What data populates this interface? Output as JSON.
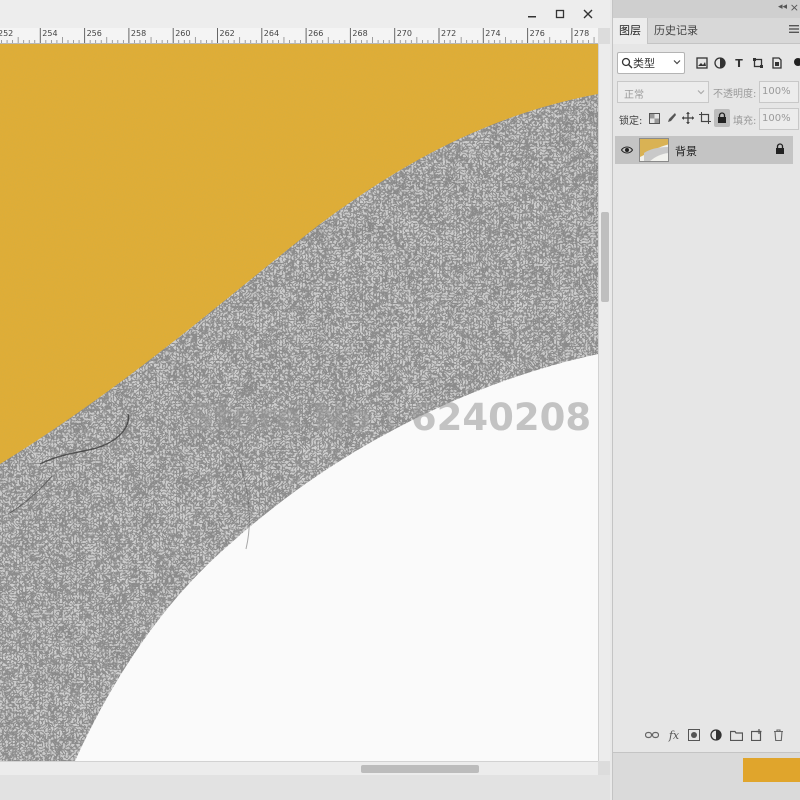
{
  "document": {
    "ruler_labels": [
      "252",
      "254",
      "256",
      "258",
      "260",
      "262",
      "264",
      "266",
      "268",
      "270",
      "272",
      "274",
      "276",
      "278"
    ],
    "watermark": "Store No : 6240208",
    "colors": {
      "gold": "#e3ad33",
      "marble": "#d3d3d3",
      "white": "#fafafa"
    }
  },
  "window_controls": [
    "minimize-icon",
    "restore-icon",
    "close-icon"
  ],
  "layers_panel": {
    "tabs": [
      {
        "label": "图层",
        "active": true
      },
      {
        "label": "历史记录",
        "active": false
      }
    ],
    "filter": {
      "kind_label": "类型",
      "icons": [
        "image-filter-icon",
        "adjustment-filter-icon",
        "type-filter-icon",
        "shape-filter-icon",
        "smart-object-filter-icon"
      ]
    },
    "blend_mode": "正常",
    "opacity_label": "不透明度:",
    "opacity_value": "100%",
    "lock_label": "锁定:",
    "fill_label": "填充:",
    "fill_value": "100%",
    "layers": [
      {
        "name": "背景",
        "visible": true,
        "locked": true,
        "selected": true
      }
    ]
  }
}
